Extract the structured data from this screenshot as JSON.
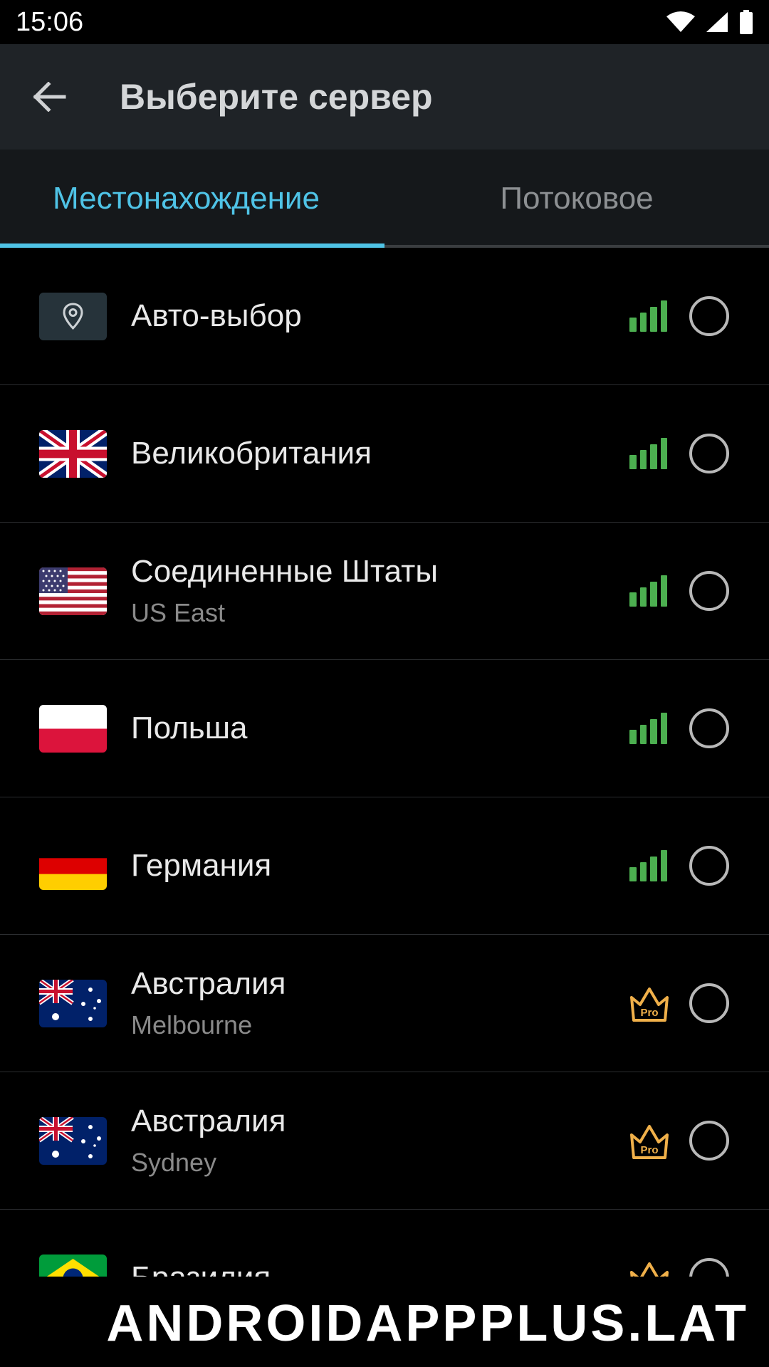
{
  "status_bar": {
    "time": "15:06"
  },
  "toolbar": {
    "title": "Выберите сервер"
  },
  "tabs": [
    {
      "label": "Местонахождение",
      "active": true
    },
    {
      "label": "Потоковое",
      "active": false
    }
  ],
  "servers": [
    {
      "name": "Авто-выбор",
      "sub": "",
      "flag": "location-pin",
      "indicator": "signal-full"
    },
    {
      "name": "Великобритания",
      "sub": "",
      "flag": "uk",
      "indicator": "signal-full"
    },
    {
      "name": "Соединенные Штаты",
      "sub": "US East",
      "flag": "us",
      "indicator": "signal-full"
    },
    {
      "name": "Польша",
      "sub": "",
      "flag": "poland",
      "indicator": "signal-full"
    },
    {
      "name": "Германия",
      "sub": "",
      "flag": "germany",
      "indicator": "signal-full"
    },
    {
      "name": "Австралия",
      "sub": "Melbourne",
      "flag": "australia",
      "indicator": "pro"
    },
    {
      "name": "Австралия",
      "sub": "Sydney",
      "flag": "australia",
      "indicator": "pro"
    },
    {
      "name": "Бразилия",
      "sub": "",
      "flag": "brazil",
      "indicator": "pro"
    }
  ],
  "pro_badge_label": "Pro",
  "watermark": "ANDROIDAPPPLUS.LAT",
  "colors": {
    "accent": "#4fc3e6",
    "signal": "#4caf50",
    "pro": "#f0b04a",
    "toolbar": "#1f2327"
  }
}
